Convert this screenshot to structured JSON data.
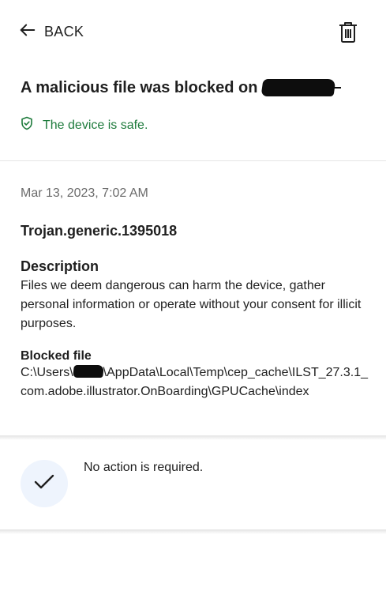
{
  "header": {
    "back_label": "BACK",
    "title": "A malicious file was blocked on",
    "status_text": "The device is safe.",
    "status_color": "#1e7b3c"
  },
  "icons": {
    "back": "arrow-left-icon",
    "delete": "trash-icon",
    "status": "shield-check-icon",
    "action": "checkmark-icon"
  },
  "detail": {
    "date": "Mar 13, 2023, 7:02 AM",
    "threat_name": "Trojan.generic.1395018",
    "description_title": "Description",
    "description_body": "Files we deem dangerous can harm the device, gather personal information or operate without your consent for illicit purposes.",
    "blocked_file_title": "Blocked file",
    "blocked_path_prefix": "C:\\Users\\",
    "blocked_path_suffix": "\\AppData\\Local\\Temp\\cep_cache\\ILST_27.3.1_com.adobe.illustrator.OnBoarding\\GPUCache\\index"
  },
  "action": {
    "text": "No action is required.",
    "icon_bg": "#eef4fd"
  }
}
